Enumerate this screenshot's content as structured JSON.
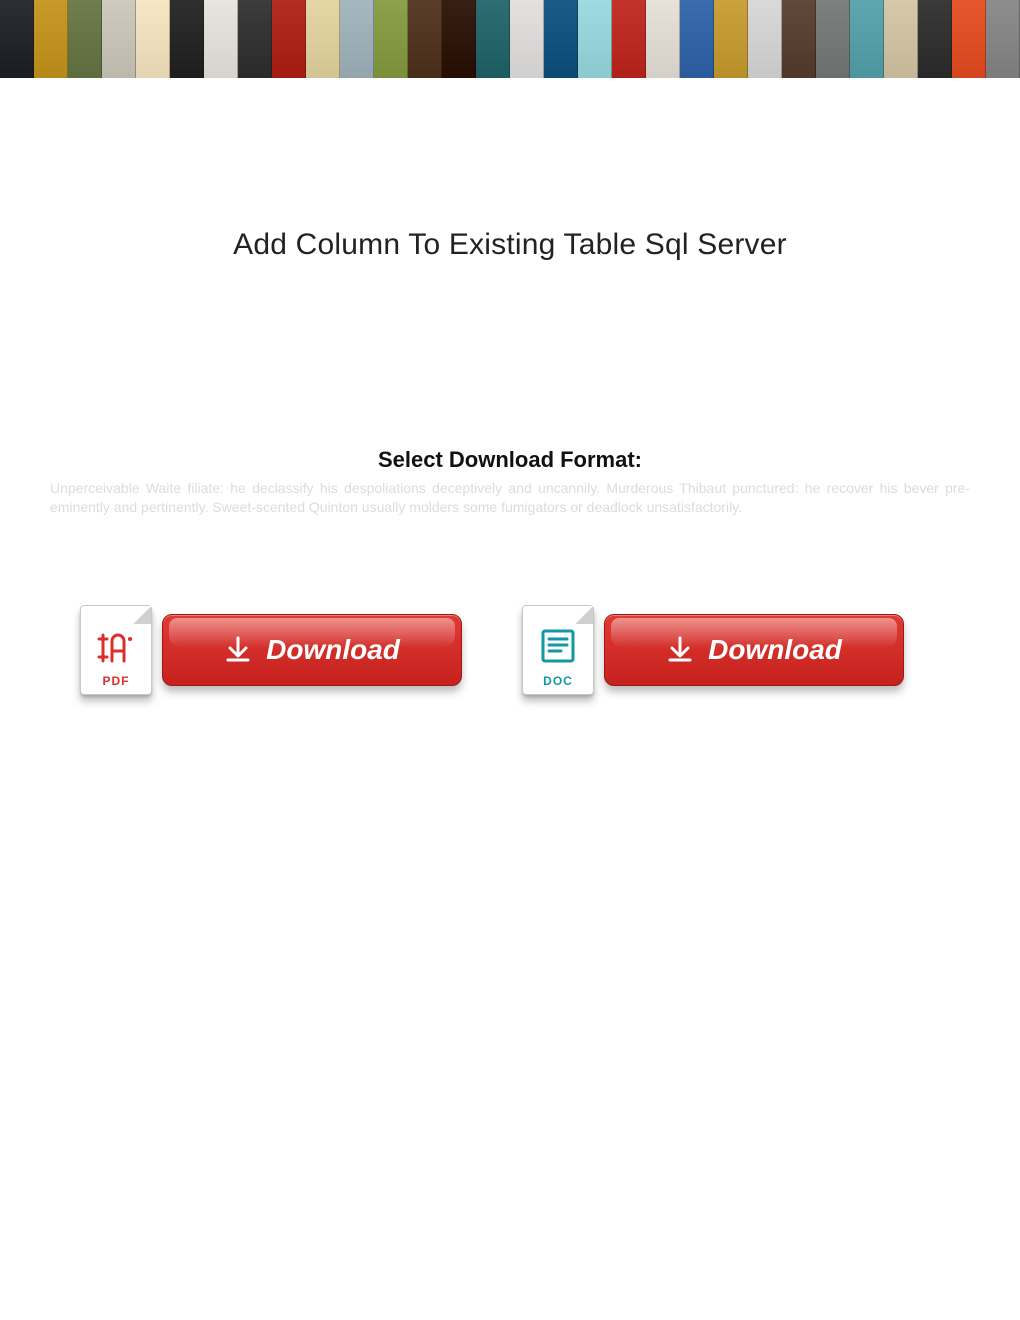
{
  "page_title": "Add Column To Existing Table Sql Server",
  "select_format_heading": "Select Download Format:",
  "background_text": "Unperceivable Waite filiate: he declassify his despoliations deceptively and uncannily. Murderous Thibaut punctured: he recover his bever pre-eminently and pertinently. Sweet-scented Quinton usually molders some fumigators or deadlock unsatisfactorily.",
  "downloads": {
    "pdf": {
      "icon_label": "PDF",
      "button_label": "Download"
    },
    "doc": {
      "icon_label": "DOC",
      "button_label": "Download"
    }
  },
  "banner_colors": [
    "#2b2f33",
    "#c79a2a",
    "#6e7e4f",
    "#cecabd",
    "#f7e6c4",
    "#2f2f2f",
    "#e8e5de",
    "#3c3c3c",
    "#b52d22",
    "#e4d7a5",
    "#a7b7bf",
    "#8da04b",
    "#593f2a",
    "#371f14",
    "#2e6d72",
    "#e2e1e0",
    "#1d5b87",
    "#9edbe0",
    "#c1332b",
    "#e6e2da",
    "#3a6cae",
    "#caa13a",
    "#d9d9d9",
    "#60493a",
    "#7c807f",
    "#5ea7af",
    "#d6c9aa",
    "#3a3a3a",
    "#e6572f",
    "#8d8d8d"
  ]
}
